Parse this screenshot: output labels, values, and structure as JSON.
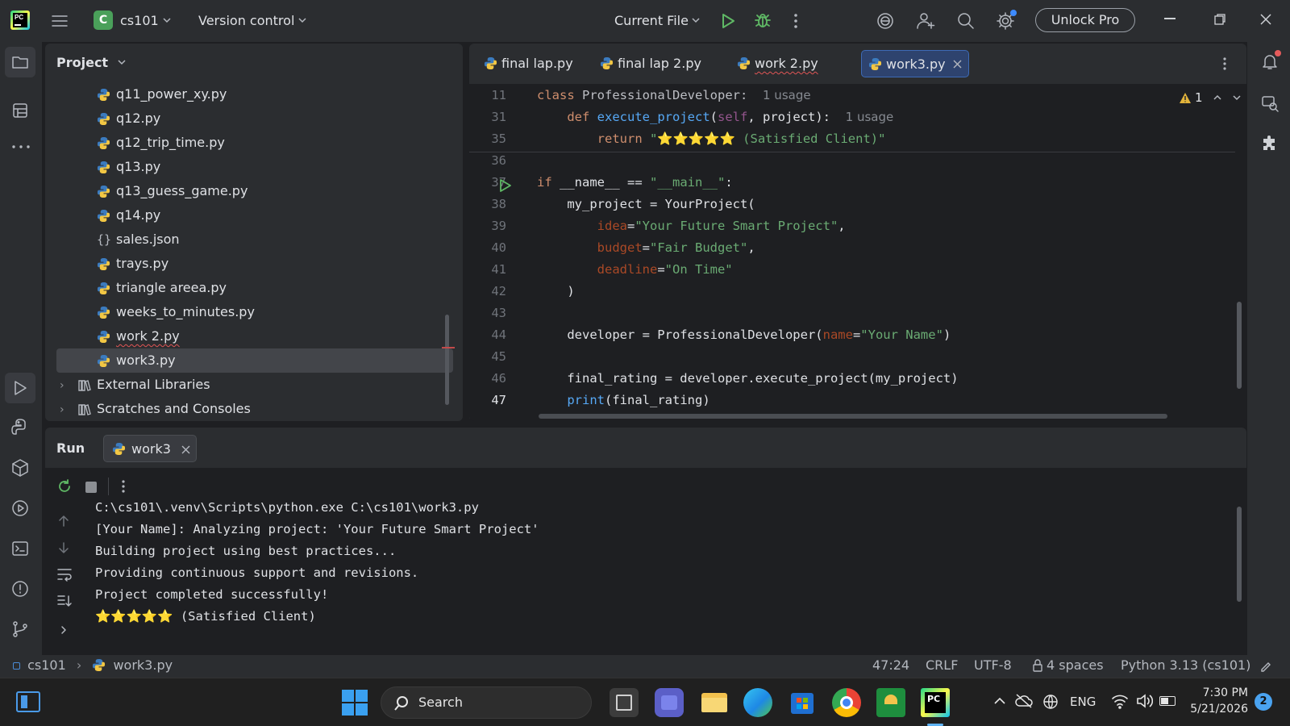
{
  "titlebar": {
    "project_letter": "C",
    "project_name": "cs101",
    "vcs": "Version control",
    "run_config": "Current File",
    "unlock": "Unlock Pro"
  },
  "project_panel": {
    "title": "Project",
    "files": [
      {
        "name": "q11_power_xy.py",
        "type": "py"
      },
      {
        "name": "q12.py",
        "type": "py"
      },
      {
        "name": "q12_trip_time.py",
        "type": "py"
      },
      {
        "name": "q13.py",
        "type": "py"
      },
      {
        "name": "q13_guess_game.py",
        "type": "py"
      },
      {
        "name": "q14.py",
        "type": "py"
      },
      {
        "name": "sales.json",
        "type": "json"
      },
      {
        "name": "trays.py",
        "type": "py"
      },
      {
        "name": "triangle areea.py",
        "type": "py"
      },
      {
        "name": "weeks_to_minutes.py",
        "type": "py"
      },
      {
        "name": "work 2.py",
        "type": "py"
      },
      {
        "name": "work3.py",
        "type": "py"
      }
    ],
    "external_libraries": "External Libraries",
    "scratches": "Scratches and Consoles"
  },
  "tabs": [
    "final lap.py",
    "final lap 2.py",
    "work 2.py",
    "work3.py"
  ],
  "editor": {
    "warning_count": "1",
    "lines": [
      {
        "n": "11",
        "html": "<span class='kw'>class</span> <span class='def'>ProfessionalDeveloper:</span>  <span class='hint'>1 usage</span>"
      },
      {
        "n": "31",
        "html": "    <span class='kw'>def</span> <span class='fn'>execute_project</span>(<span class='self'>self</span>, project):  <span class='hint'>1 usage</span>"
      },
      {
        "n": "35",
        "html": "        <span class='kw'>return</span> <span class='st'>\"⭐⭐⭐⭐⭐ (Satisfied Client)\"</span>"
      },
      {
        "n": "36",
        "html": ""
      },
      {
        "n": "37",
        "html": "<span class='kw'>if</span> __name__ == <span class='st'>\"__main__\"</span>:"
      },
      {
        "n": "38",
        "html": "    my_project = YourProject("
      },
      {
        "n": "39",
        "html": "        <span class='par'>idea</span>=<span class='st'>\"Your Future Smart Project\"</span>,"
      },
      {
        "n": "40",
        "html": "        <span class='par'>budget</span>=<span class='st'>\"Fair Budget\"</span>,"
      },
      {
        "n": "41",
        "html": "        <span class='par'>deadline</span>=<span class='st'>\"On Time\"</span>"
      },
      {
        "n": "42",
        "html": "    )"
      },
      {
        "n": "43",
        "html": ""
      },
      {
        "n": "44",
        "html": "    developer = ProfessionalDeveloper(<span class='par'>name</span>=<span class='st'>\"Your Name\"</span>)"
      },
      {
        "n": "45",
        "html": ""
      },
      {
        "n": "46",
        "html": "    final_rating = developer.execute_project(my_project)"
      },
      {
        "n": "47",
        "html": "    <span class='fn'>print</span>(final_rating)"
      }
    ]
  },
  "run_panel": {
    "title": "Run",
    "tab": "work3",
    "output": [
      "C:\\cs101\\.venv\\Scripts\\python.exe C:\\cs101\\work3.py",
      "[Your Name]: Analyzing project: 'Your Future Smart Project'",
      "Building project using best practices...",
      "Providing continuous support and revisions.",
      "Project completed successfully!",
      "⭐⭐⭐⭐⭐ (Satisfied Client)"
    ]
  },
  "statusbar": {
    "crumb_project": "cs101",
    "crumb_file": "work3.py",
    "position": "47:24",
    "line_sep": "CRLF",
    "encoding": "UTF-8",
    "indent": "4 spaces",
    "interpreter": "Python 3.13 (cs101)"
  },
  "taskbar": {
    "search": "Search",
    "lang": "ENG",
    "time": "7:30 PM",
    "date": "5/21/2026",
    "notif_count": "2"
  }
}
